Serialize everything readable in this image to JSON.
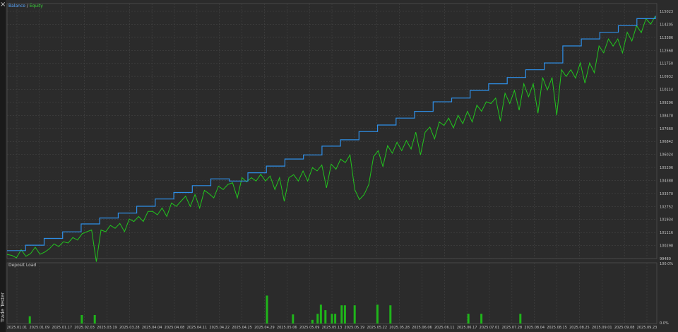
{
  "panel": {
    "close_symbol": "×",
    "side_label": "Trade Tester"
  },
  "colors": {
    "background": "#2b2b2b",
    "grid": "#4a4a4a",
    "balance": "#2e8fe8",
    "equity": "#22c41e",
    "load": "#1fb51a",
    "text": "#c8c8c8",
    "legend_balance": "#5aa8ff",
    "legend_equity": "#3ad43a"
  },
  "chart_data": [
    {
      "type": "line",
      "legend": {
        "balance": "Balance",
        "separator": " / ",
        "equity": "Equity"
      },
      "ylim": [
        99908,
        115023
      ],
      "y_ticks": [
        115023,
        114205,
        113386,
        112568,
        111750,
        110932,
        110114,
        109296,
        108478,
        107660,
        106842,
        106024,
        105206,
        104388,
        103570,
        102752,
        101934,
        101116,
        100298,
        99480
      ],
      "y_tick_labels": [
        "115023",
        "114205",
        "113386",
        "112568",
        "111750",
        "110932",
        "110114",
        "109296",
        "108478",
        "107660",
        "106842",
        "106024",
        "105206",
        "104388",
        "103570",
        "102752",
        "101934",
        "101116",
        "100298",
        "99480"
      ],
      "x_tick_labels": [
        "2025.01.01",
        "2025.01.09",
        "2025.01.17",
        "2025.02.03",
        "2025.03.19",
        "2025.03.28",
        "2025.04.04",
        "2025.04.08",
        "2025.04.11",
        "2025.04.22",
        "2025.04.25",
        "2025.04.29",
        "2025.05.06",
        "2025.05.09",
        "2025.05.13",
        "2025.05.19",
        "2025.05.22",
        "2025.05.28",
        "2025.06.06",
        "2025.06.11",
        "2025.06.17",
        "2025.07.01",
        "2025.07.28",
        "2025.08.04",
        "2025.08.15",
        "2025.08.25",
        "2025.09.01",
        "2025.09.08",
        "2025.09.23"
      ],
      "balance_series": [
        100378,
        100698,
        101101,
        101492,
        101959,
        102312,
        102604,
        103008,
        103438,
        103823,
        104227,
        104631,
        104500,
        104990,
        105390,
        105807,
        106048,
        106570,
        106946,
        107433,
        107822,
        108230,
        108633,
        109197,
        109420,
        109875,
        110265,
        110640,
        111100,
        111500,
        112510,
        112927,
        113317,
        113713,
        114128,
        114290
      ],
      "equity_series": [
        100150,
        100098,
        99950,
        100430,
        100040,
        100201,
        100580,
        100160,
        100290,
        100480,
        100780,
        100620,
        100900,
        100830,
        101150,
        101000,
        101380,
        101500,
        101600,
        99720,
        101600,
        101500,
        101870,
        101700,
        101990,
        101500,
        102250,
        102100,
        102400,
        102100,
        102700,
        102700,
        102500,
        102900,
        102400,
        103200,
        103000,
        103300,
        103600,
        103000,
        103700,
        102900,
        103950,
        103750,
        103500,
        104200,
        104000,
        104300,
        104400,
        103500,
        104700,
        104450,
        104700,
        104500,
        104900,
        104500,
        104800,
        104000,
        104700,
        103300,
        104700,
        104880,
        104500,
        105100,
        104500,
        105300,
        105100,
        105450,
        104100,
        105500,
        105200,
        105800,
        105600,
        106050,
        104000,
        103400,
        103700,
        104300,
        105950,
        106300,
        105350,
        106600,
        106150,
        106800,
        106300,
        106900,
        106400,
        107400,
        106050,
        107400,
        107700,
        107000,
        108000,
        107800,
        108230,
        107650,
        108400,
        107900,
        108633,
        108000,
        109000,
        108633,
        109197,
        109100,
        109420,
        108050,
        109700,
        109100,
        109875,
        108700,
        110265,
        109500,
        110265,
        108520,
        110640,
        109900,
        110640,
        108400,
        111100,
        110700,
        111100,
        110600,
        111500,
        110300,
        111500,
        110920,
        112510,
        112100,
        112927,
        112500,
        112927,
        112100,
        113317,
        112800,
        113713,
        113300,
        114128,
        113800,
        114290
      ]
    },
    {
      "type": "bar",
      "title": "Deposit Load",
      "ylim": [
        0,
        100
      ],
      "y_tick_labels": [
        "100.0%",
        "0.0%"
      ],
      "x": [
        0.035,
        0.115,
        0.135,
        0.4,
        0.44,
        0.47,
        0.478,
        0.483,
        0.49,
        0.5,
        0.505,
        0.515,
        0.52,
        0.535,
        0.57,
        0.59,
        0.71,
        0.73,
        0.79
      ],
      "values": [
        12,
        14,
        14,
        46,
        15,
        6,
        16,
        31,
        22,
        16,
        16,
        30,
        30,
        30,
        31,
        30,
        16,
        16,
        16
      ]
    }
  ]
}
